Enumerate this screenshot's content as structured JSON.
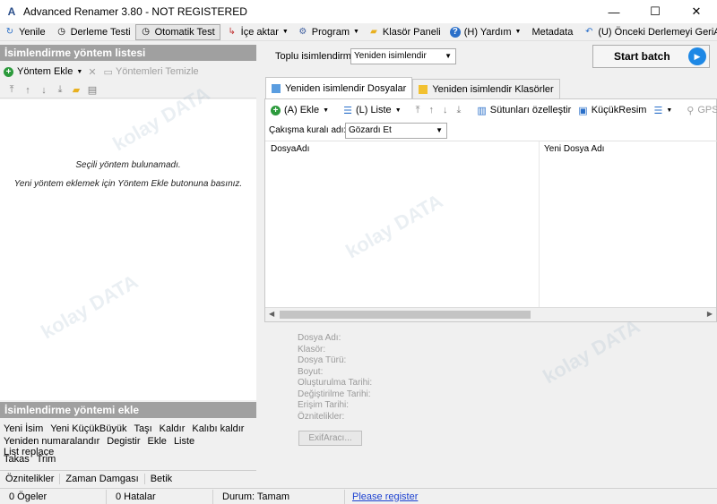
{
  "window": {
    "title": "Advanced Renamer 3.80 - NOT REGISTERED",
    "minimize": "—",
    "maximize": "☐",
    "close": "✕"
  },
  "menu": [
    {
      "label": "Yenile",
      "icon": "refresh-icon",
      "glyph": "↻"
    },
    {
      "label": "Derleme Testi",
      "icon": "clock-icon",
      "glyph": "◷"
    },
    {
      "label": "Otomatik Test",
      "icon": "clock-icon",
      "glyph": "◷"
    },
    {
      "label": "İçe aktar",
      "icon": "import-icon",
      "glyph": "↳"
    },
    {
      "label": "Program",
      "icon": "program-icon",
      "glyph": "⚙"
    },
    {
      "label": "Klasör Paneli",
      "icon": "folder-icon",
      "glyph": "▰"
    },
    {
      "label": "(H) Yardım",
      "icon": "help-icon",
      "glyph": "?"
    },
    {
      "label": "Metadata",
      "icon": "",
      "glyph": ""
    },
    {
      "label": "(U) Önceki Derlemeyi GeriAl",
      "icon": "undo-icon",
      "glyph": "↶"
    }
  ],
  "left_panel": {
    "header": "İsimlendirme yöntem listesi",
    "add_method": "Yöntem Ekle",
    "clear_methods": "Yöntemleri Temizle",
    "empty_line1": "Seçili yöntem bulunamadı.",
    "empty_line2": "Yeni yöntem eklemek için Yöntem Ekle butonuna basınız."
  },
  "add_panel": {
    "header": "İsimlendirme yöntemi ekle",
    "row1": [
      "Yeni İsim",
      "Yeni KüçükBüyük",
      "Taşı",
      "Kaldır",
      "Kalıbı kaldır"
    ],
    "row2": [
      "Yeniden numaralandır",
      "Degistir",
      "Ekle",
      "Liste",
      "List replace"
    ],
    "row3": [
      "Takas",
      "Trim"
    ],
    "extra": [
      "Öznitelikler",
      "Zaman Damgası",
      "Betik"
    ]
  },
  "batch": {
    "label": "Toplu isimlendirme mod",
    "mode_value": "Yeniden isimlendir",
    "start_label": "Start batch"
  },
  "tabs": [
    {
      "label": "Yeniden isimlendir Dosyalar",
      "active": true
    },
    {
      "label": "Yeniden isimlendir Klasörler",
      "active": false
    }
  ],
  "files_toolbar": {
    "add": "(A) Ekle",
    "list": "(L) Liste",
    "columns": "Sütunları özelleştir",
    "thumbnail": "KüçükResim",
    "gps": "GPS Values"
  },
  "rule": {
    "label": "Çakışma kuralı adı:",
    "value": "Gözardı Et"
  },
  "grid": {
    "col1": "DosyaAdı",
    "col2": "Yeni Dosya Adı"
  },
  "props": [
    "Dosya Adı:",
    "Klasör:",
    "Dosya Türü:",
    "Boyut:",
    "Oluşturulma Tarihi:",
    "Değiştirilme Tarihi:",
    "Erişim Tarihi:",
    "Öznitelikler:"
  ],
  "exif_button": "ExifAracı...",
  "status": {
    "items": "0 Ögeler",
    "errors": "0 Hatalar",
    "state": "Durum: Tamam",
    "register": "Please register"
  },
  "watermark": "kolay DATA"
}
